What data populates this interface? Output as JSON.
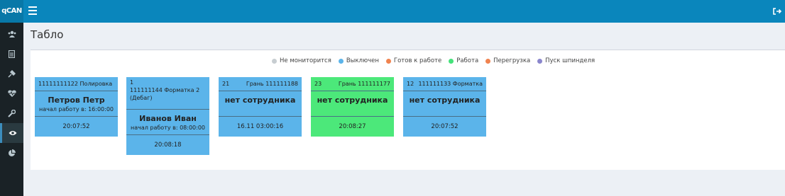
{
  "app": {
    "brand": "qCAN"
  },
  "page": {
    "title": "Табло"
  },
  "legend": [
    {
      "label": "Не мониторится",
      "color": "#c7cdd1"
    },
    {
      "label": "Выключен",
      "color": "#5bb4ea"
    },
    {
      "label": "Готов к работе",
      "color": "#f0834f"
    },
    {
      "label": "Работа",
      "color": "#44e27a"
    },
    {
      "label": "Перегрузка",
      "color": "#f0834f"
    },
    {
      "label": "Пуск шпинделя",
      "color": "#8a86cc"
    }
  ],
  "sidebar": {
    "items": [
      {
        "icon": "users-icon"
      },
      {
        "icon": "document-icon"
      },
      {
        "icon": "wrench-plug-icon"
      },
      {
        "icon": "heartbeat-icon"
      },
      {
        "icon": "tool-icon"
      },
      {
        "icon": "eye-icon",
        "active": true
      },
      {
        "icon": "pie-chart-icon"
      }
    ]
  },
  "cards": [
    {
      "number": "",
      "head": "11111111122 Полировка",
      "name": "Петров Петр",
      "start": "начал работу в: 16:00:00",
      "time": "20:07:52",
      "status": "Выключен",
      "color": "#5bb4ea"
    },
    {
      "number": "1",
      "head": "111111144 Форматка 2 (Дебаг)",
      "name": "Иванов Иван",
      "start": "начал работу в: 08:00:00",
      "time": "20:08:18",
      "status": "Выключен",
      "color": "#5bb4ea"
    },
    {
      "number": "21",
      "head": "Грань 111111188",
      "name": "нет сотрудника",
      "start": "",
      "time": "16.11 03:00:16",
      "status": "Выключен",
      "color": "#5bb4ea"
    },
    {
      "number": "23",
      "head": "Грань 111111177",
      "name": "нет сотрудника",
      "start": "",
      "time": "20:08:27",
      "status": "Работа",
      "color": "#4ce87a"
    },
    {
      "number": "12",
      "head": "111111133 Форматка",
      "name": "нет сотрудника",
      "start": "",
      "time": "20:07:52",
      "status": "Выключен",
      "color": "#5bb4ea"
    }
  ]
}
